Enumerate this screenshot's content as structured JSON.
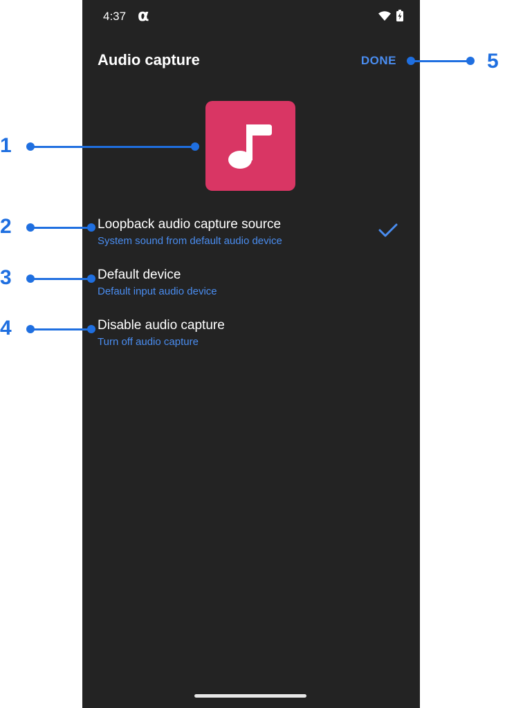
{
  "status_bar": {
    "time": "4:37",
    "carrier_glyph": "α",
    "icons": [
      "wifi-icon",
      "battery-charging-icon"
    ]
  },
  "app_bar": {
    "title": "Audio capture",
    "done_label": "DONE"
  },
  "tile": {
    "icon": "music-note-icon",
    "color": "#d93664"
  },
  "options": [
    {
      "title": "Loopback audio capture source",
      "subtitle": "System sound from default audio device",
      "selected": true
    },
    {
      "title": "Default device",
      "subtitle": "Default input audio device",
      "selected": false
    },
    {
      "title": "Disable audio capture",
      "subtitle": "Turn off audio capture",
      "selected": false
    }
  ],
  "annotations": [
    "1",
    "2",
    "3",
    "4",
    "5"
  ],
  "colors": {
    "accent": "#4a8df0",
    "annotation": "#1f6fe0",
    "background": "#232323"
  }
}
